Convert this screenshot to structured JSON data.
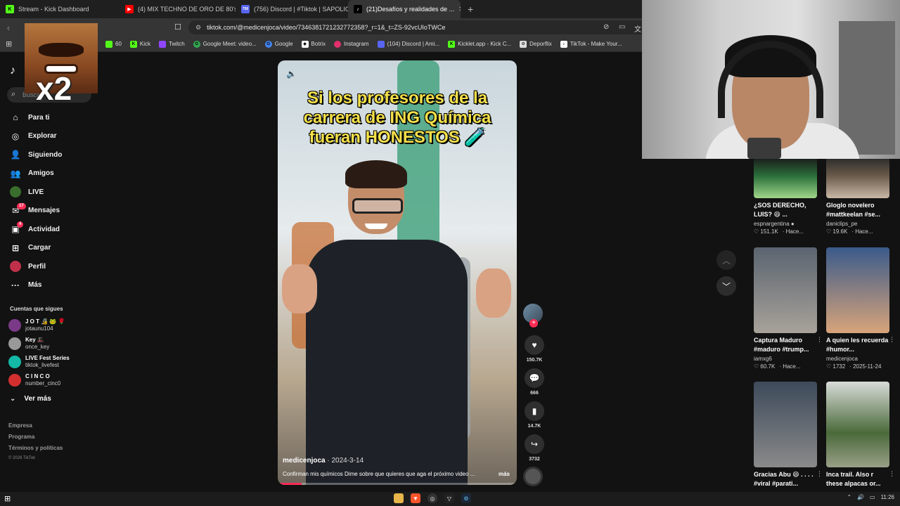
{
  "tabs": [
    {
      "label": "Stream - Kick Dashboard",
      "fav_color": "#53fc18",
      "fav_text": "K"
    },
    {
      "label": "(4) MIX TECHNO DE ORO DE 80's & 9",
      "fav_color": "#ff0000",
      "fav_text": "▶"
    },
    {
      "label": "(756) Discord | #Tiktok | SAPOLIO",
      "fav_color": "#5865f2",
      "fav_text": "756"
    },
    {
      "label": "(21)Desafíos y realidades de ...",
      "fav_color": "#ffffff",
      "fav_text": "♪",
      "active": true
    }
  ],
  "address": {
    "url": "tiktok.com/@medicenjoca/video/7346381721232772358?_r=1&_t=ZS-92vcUIoTWCe"
  },
  "bookmarks": [
    {
      "label": "60",
      "color": "#53fc18"
    },
    {
      "label": "Kick",
      "color": "#53fc18"
    },
    {
      "label": "Twitch",
      "color": "#9146ff"
    },
    {
      "label": "Google Meet: video...",
      "color": "#34a853"
    },
    {
      "label": "Google",
      "color": "#4285f4"
    },
    {
      "label": "Botrix",
      "color": "#ffffff"
    },
    {
      "label": "Instagram",
      "color": "#e1306c"
    },
    {
      "label": "(104) Discord | Ami...",
      "color": "#5865f2"
    },
    {
      "label": "Kicklet.app - Kick C...",
      "color": "#53fc18"
    },
    {
      "label": "Deporflix",
      "color": "#dddddd"
    },
    {
      "label": "TikTok - Make Your...",
      "color": "#ffffff"
    }
  ],
  "emote": {
    "text": "x2"
  },
  "sidebar": {
    "search_placeholder": "Buscar",
    "nav": [
      {
        "label": "Para ti",
        "icon": "⌂",
        "name": "home-icon"
      },
      {
        "label": "Explorar",
        "icon": "◎",
        "name": "compass-icon"
      },
      {
        "label": "Siguiendo",
        "icon": "👤",
        "name": "following-icon"
      },
      {
        "label": "Amigos",
        "icon": "👥",
        "name": "friends-icon"
      },
      {
        "label": "LIVE",
        "icon": "LIVE",
        "name": "live-icon"
      },
      {
        "label": "Mensajes",
        "icon": "✉",
        "name": "messages-icon",
        "badge": "17"
      },
      {
        "label": "Actividad",
        "icon": "▣",
        "name": "activity-icon",
        "badge": "4"
      },
      {
        "label": "Cargar",
        "icon": "⊞",
        "name": "upload-icon"
      },
      {
        "label": "Perfil",
        "icon": "●",
        "name": "profile-icon"
      },
      {
        "label": "Más",
        "icon": "···",
        "name": "more-icon"
      }
    ],
    "following_heading": "Cuentas que sigues",
    "following": [
      {
        "name": "J O T 🔏 🐸 🌹",
        "user": "jotaunu104",
        "color": "#7a3a88"
      },
      {
        "name": "Key 🎩",
        "user": "once_key",
        "color": "#999999"
      },
      {
        "name": "LIVE Fest Series",
        "user": "tiktok_livefest",
        "color": "#14b8a6"
      },
      {
        "name": "C I N C O",
        "user": "number_cinc0",
        "color": "#d32f2f"
      }
    ],
    "see_more": "Ver más",
    "footer": [
      "Empresa",
      "Programa",
      "Términos y políticas"
    ],
    "copyright": "© 2026 TikTok"
  },
  "video": {
    "caption": "Si los profesores de la carrera de ING Química fueran HONESTOS 🧪",
    "author": "medicenjoca",
    "date": "· 2024-3-14",
    "description": "Confirman mis químicos Dime sobre que quieres que aga el próximo video ...",
    "more": "más",
    "progress": 0.1
  },
  "actions": {
    "likes": "150.7K",
    "comments": "666",
    "saves": "14.7K",
    "shares": "3732"
  },
  "feed": [
    {
      "title": "¿SOS DERECHO, LUIS? 😄 ...",
      "user": "espnargentina ●",
      "stat": "♡ 151.1K",
      "age": "· Hace...",
      "colors": [
        "#2a6e3a",
        "#9fd68a"
      ]
    },
    {
      "title": "Gloglo novelero #mattkeelan #se...",
      "user": "daniclips_pe",
      "stat": "♡ 19.6K",
      "age": "· Hace...",
      "colors": [
        "#6a5a4a",
        "#c9b8a6"
      ]
    },
    {
      "title": "Captura Maduro #maduro #trump...",
      "user": "iamxg6",
      "stat": "♡ 60.7K",
      "age": "· Hace...",
      "colors": [
        "#5a6470",
        "#a8a29a"
      ]
    },
    {
      "title": "A quien les recuerda #humor...",
      "user": "medicenjoca",
      "stat": "♡ 1732",
      "age": "· 2025-11-24",
      "colors": [
        "#3a5a8a",
        "#d8a47a"
      ]
    },
    {
      "title": "Gracias Abu 😄 . . . . #viral #parati...",
      "user": "",
      "stat": "",
      "age": "",
      "colors": [
        "#3d4a5a",
        "#8a8a8a"
      ]
    },
    {
      "title": "Inca trail. Also r these alpacas or...",
      "user": "",
      "stat": "",
      "age": "",
      "colors": [
        "#4a6a3a",
        "#9aa088"
      ]
    }
  ],
  "taskbar": {
    "time": "11:26"
  }
}
